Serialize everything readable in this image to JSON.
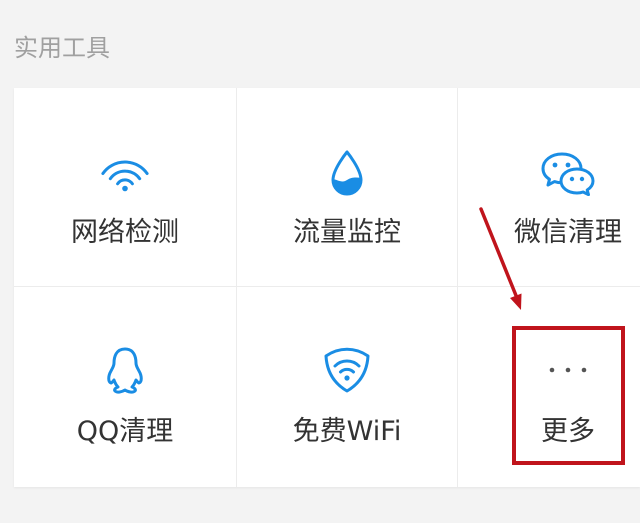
{
  "section": {
    "title": "实用工具"
  },
  "tools": [
    {
      "label": "网络检测",
      "icon": "wifi-icon"
    },
    {
      "label": "流量监控",
      "icon": "water-drop-icon"
    },
    {
      "label": "微信清理",
      "icon": "wechat-icon"
    },
    {
      "label": "QQ清理",
      "icon": "qq-penguin-icon"
    },
    {
      "label": "免费WiFi",
      "icon": "shield-wifi-icon"
    },
    {
      "label": "更多",
      "icon": "more-dots-icon"
    }
  ],
  "colors": {
    "accent": "#1a8de4",
    "background": "#f3f3f3",
    "card": "#ffffff",
    "label": "#333333",
    "section_title": "#a0a0a0",
    "annotation": "#c0141c"
  }
}
